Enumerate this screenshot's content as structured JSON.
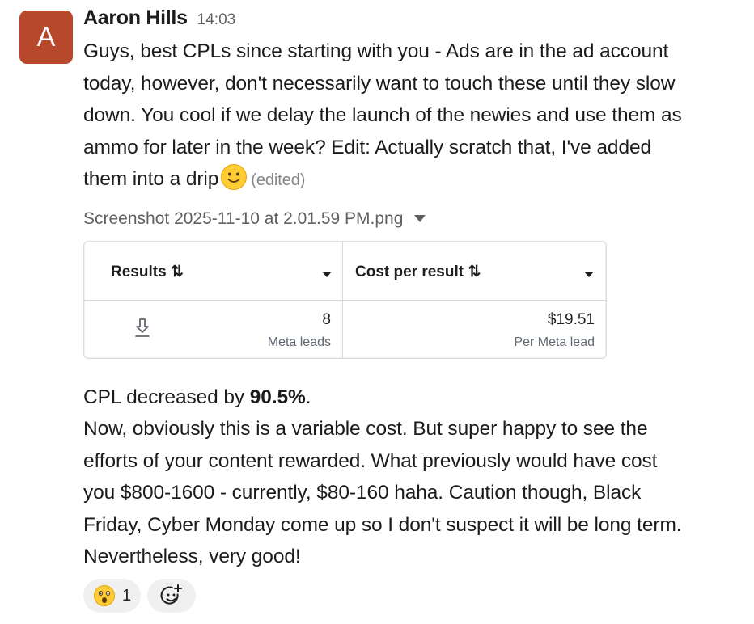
{
  "message": {
    "avatar_letter": "A",
    "avatar_color": "#b8482c",
    "sender": "Aaron Hills",
    "timestamp": "14:03",
    "text_line1": "Guys, best CPLs since starting with you - Ads are in the ad account",
    "text_line2": "today, however, don't necessarily want to touch these until they slow",
    "text_line3": "down. You cool if we delay the launch of the newies and use them as",
    "text_line4": "ammo for later in the week? Edit: Actually scratch that, I've added",
    "text_line5": "them into a drip",
    "emoji": "slightly-smiling-face",
    "edited_label": "(edited)"
  },
  "attachment": {
    "file_name": "Screenshot 2025-11-10 at 2.01.59 PM.png",
    "table": {
      "columns": [
        {
          "title": "Results ⇅",
          "value": "8",
          "sub": "Meta leads"
        },
        {
          "title": "Cost per result ⇅",
          "value": "$19.51",
          "sub": "Per Meta lead"
        }
      ],
      "row_icon": "download-icon"
    }
  },
  "body": {
    "line1_prefix": "CPL decreased by ",
    "line1_bold": "90.5%",
    "line1_suffix": ".",
    "line2": "Now, obviously this is a variable cost. But super happy to see the",
    "line3": "efforts of your content rewarded. What previously would have cost",
    "line4": "you $800-1600 - currently, $80-160 haha. Caution though, Black",
    "line5": "Friday, Cyber Monday come up so I don't suspect it will be long term.",
    "line6": "Nevertheless, very good!"
  },
  "reactions": [
    {
      "emoji": "astonished-face",
      "count": "1"
    }
  ],
  "add_reaction_icon": "add-reaction-icon"
}
